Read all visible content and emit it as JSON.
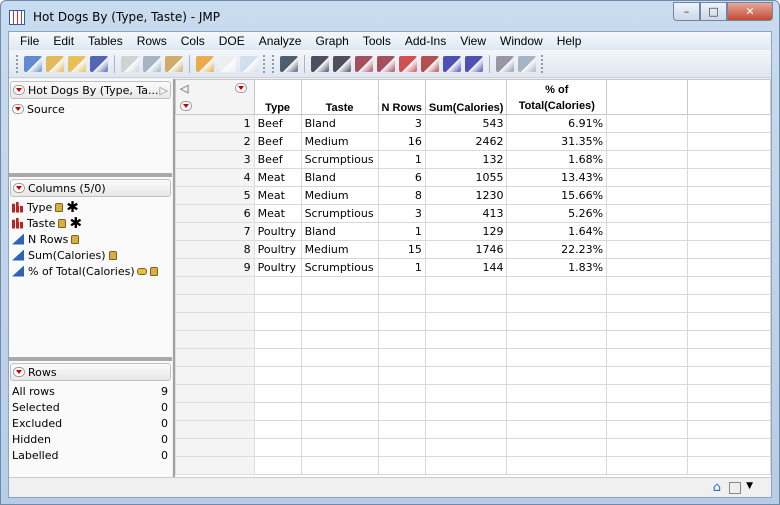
{
  "window": {
    "title": "Hot Dogs By (Type, Taste) - JMP",
    "minimize": "–",
    "maximize": "□",
    "close": "✕"
  },
  "menu": [
    "File",
    "Edit",
    "Tables",
    "Rows",
    "Cols",
    "DOE",
    "Analyze",
    "Graph",
    "Tools",
    "Add-Ins",
    "View",
    "Window",
    "Help"
  ],
  "table_panel": {
    "title": "Hot Dogs By (Type, Ta...",
    "source": "Source"
  },
  "columns_panel": {
    "title": "Columns (5/0)",
    "columns": [
      {
        "name": "Type",
        "kind": "nominal",
        "locked": true,
        "grouping": true
      },
      {
        "name": "Taste",
        "kind": "nominal",
        "locked": true,
        "grouping": true
      },
      {
        "name": "N Rows",
        "kind": "continuous",
        "locked": true
      },
      {
        "name": "Sum(Calories)",
        "kind": "continuous",
        "locked": true
      },
      {
        "name": "% of Total(Calories)",
        "kind": "continuous",
        "locked": true,
        "formula": true
      }
    ]
  },
  "rows_panel": {
    "title": "Rows",
    "stats": [
      {
        "label": "All rows",
        "value": "9"
      },
      {
        "label": "Selected",
        "value": "0"
      },
      {
        "label": "Excluded",
        "value": "0"
      },
      {
        "label": "Hidden",
        "value": "0"
      },
      {
        "label": "Labelled",
        "value": "0"
      }
    ]
  },
  "grid": {
    "headers": [
      "Type",
      "Taste",
      "N Rows",
      "Sum(Calories)",
      "% of Total(Calories)"
    ],
    "rows": [
      [
        "1",
        "Beef",
        "Bland",
        "3",
        "543",
        "6.91%"
      ],
      [
        "2",
        "Beef",
        "Medium",
        "16",
        "2462",
        "31.35%"
      ],
      [
        "3",
        "Beef",
        "Scrumptious",
        "1",
        "132",
        "1.68%"
      ],
      [
        "4",
        "Meat",
        "Bland",
        "6",
        "1055",
        "13.43%"
      ],
      [
        "5",
        "Meat",
        "Medium",
        "8",
        "1230",
        "15.66%"
      ],
      [
        "6",
        "Meat",
        "Scrumptious",
        "3",
        "413",
        "5.26%"
      ],
      [
        "7",
        "Poultry",
        "Bland",
        "1",
        "129",
        "1.64%"
      ],
      [
        "8",
        "Poultry",
        "Medium",
        "15",
        "1746",
        "22.23%"
      ],
      [
        "9",
        "Poultry",
        "Scrumptious",
        "1",
        "144",
        "1.83%"
      ]
    ]
  }
}
